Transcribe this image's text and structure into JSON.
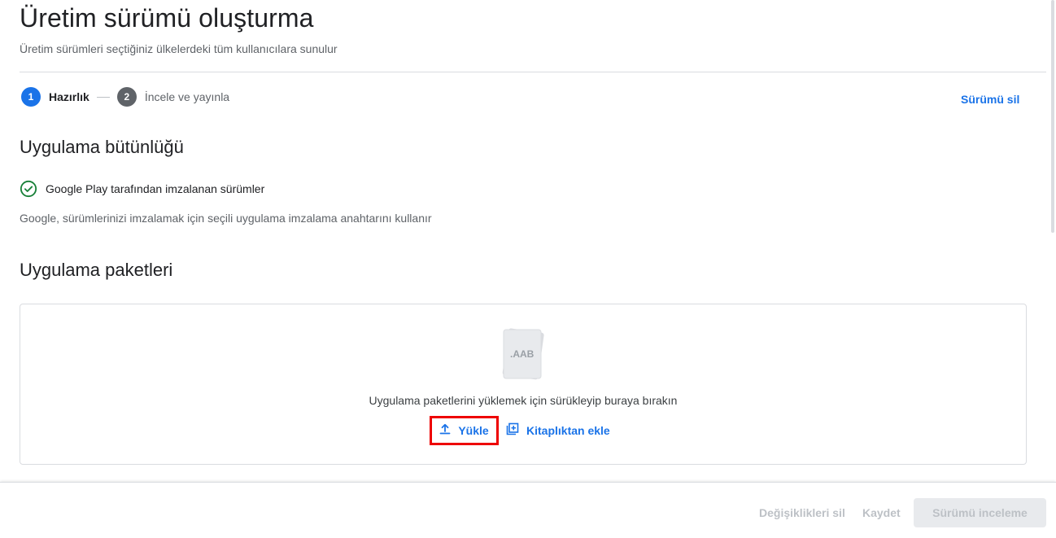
{
  "header": {
    "title": "Üretim sürümü oluşturma",
    "subtitle": "Üretim sürümleri seçtiğiniz ülkelerdeki tüm kullanıcılara sunulur"
  },
  "stepper": {
    "steps": [
      {
        "number": "1",
        "label": "Hazırlık",
        "state": "active"
      },
      {
        "number": "2",
        "label": "İncele ve yayınla",
        "state": "inactive"
      }
    ]
  },
  "actions": {
    "delete_release": "Sürümü sil"
  },
  "app_integrity": {
    "title": "Uygulama bütünlüğü",
    "status_icon": "check-circle-icon",
    "status_label": "Google Play tarafından imzalanan sürümler",
    "description": "Google, sürümlerinizi imzalamak için seçili uygulama imzalama anahtarını kullanır"
  },
  "app_bundles": {
    "title": "Uygulama paketleri",
    "illustration_label": ".AAB",
    "drop_text": "Uygulama paketlerini yüklemek için sürükleyip buraya bırakın",
    "upload_label": "Yükle",
    "upload_icon": "upload-icon",
    "library_label": "Kitaplıktan ekle",
    "library_icon": "library-add-icon"
  },
  "footer": {
    "discard_label": "Değişiklikleri sil",
    "save_label": "Kaydet",
    "review_label": "Sürümü inceleme"
  },
  "colors": {
    "accent": "#1a73e8",
    "success": "#188038",
    "highlight": "#e00000",
    "disabled_text": "#bdc1c6"
  }
}
